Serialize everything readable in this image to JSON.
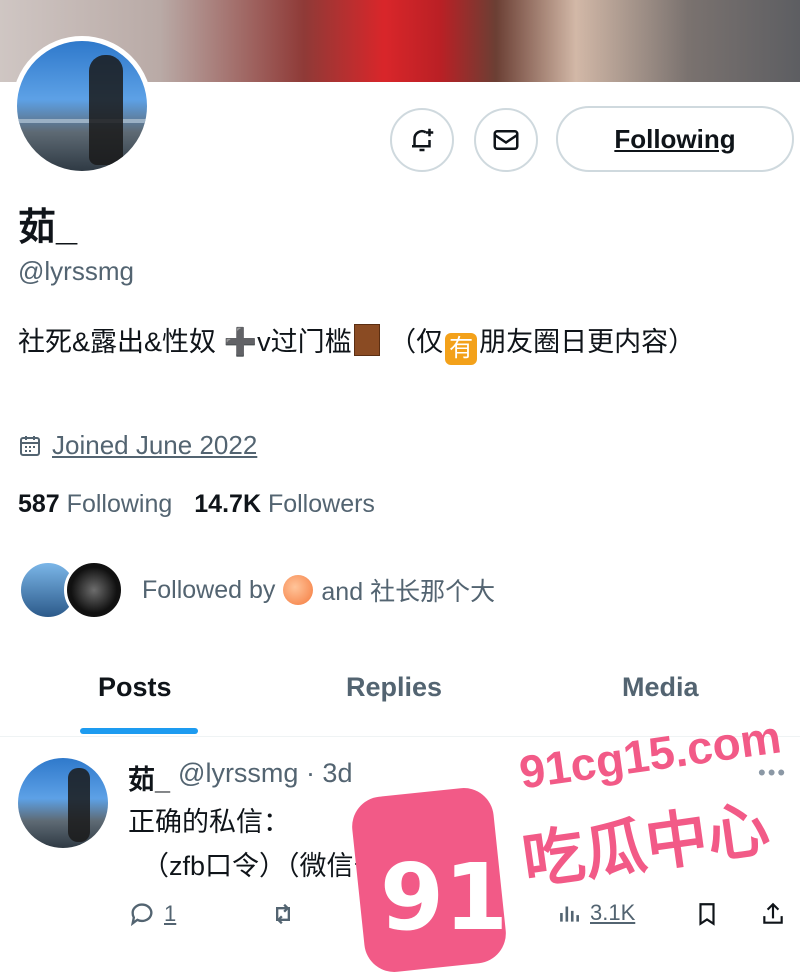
{
  "profile": {
    "display_name": "茹_",
    "handle": "@lyrssmg",
    "bio_part1": "社死&露出&性奴 ➕v过门槛",
    "bio_part2": "（仅",
    "bio_badge": "有",
    "bio_part3": "朋友圈日更内容）",
    "joined": "Joined June 2022",
    "following_count": "587",
    "following_label": "Following",
    "followers_count": "14.7K",
    "followers_label": "Followers",
    "followed_by_prefix": "Followed by",
    "followed_by_suffix": "and 社长那个大"
  },
  "header_buttons": {
    "follow_label": "Following",
    "icons": [
      "notification-add-icon",
      "mail-icon"
    ]
  },
  "tabs": [
    {
      "label": "Posts",
      "active": true
    },
    {
      "label": "Replies",
      "active": false
    },
    {
      "label": "Media",
      "active": false
    }
  ],
  "post": {
    "name": "茹_",
    "handle_time": "@lyrssmg · 3d",
    "line1": "正确的私信：",
    "line2": "（zfb口令）（微信号码）",
    "replies": "1",
    "likes": "0",
    "views": "3.1K"
  },
  "watermark": {
    "number": "91",
    "url": "91cg15.com",
    "text": "吃瓜中心"
  },
  "colors": {
    "accent": "#1d9bf0",
    "muted": "#536471",
    "watermark": "#f25a87"
  }
}
